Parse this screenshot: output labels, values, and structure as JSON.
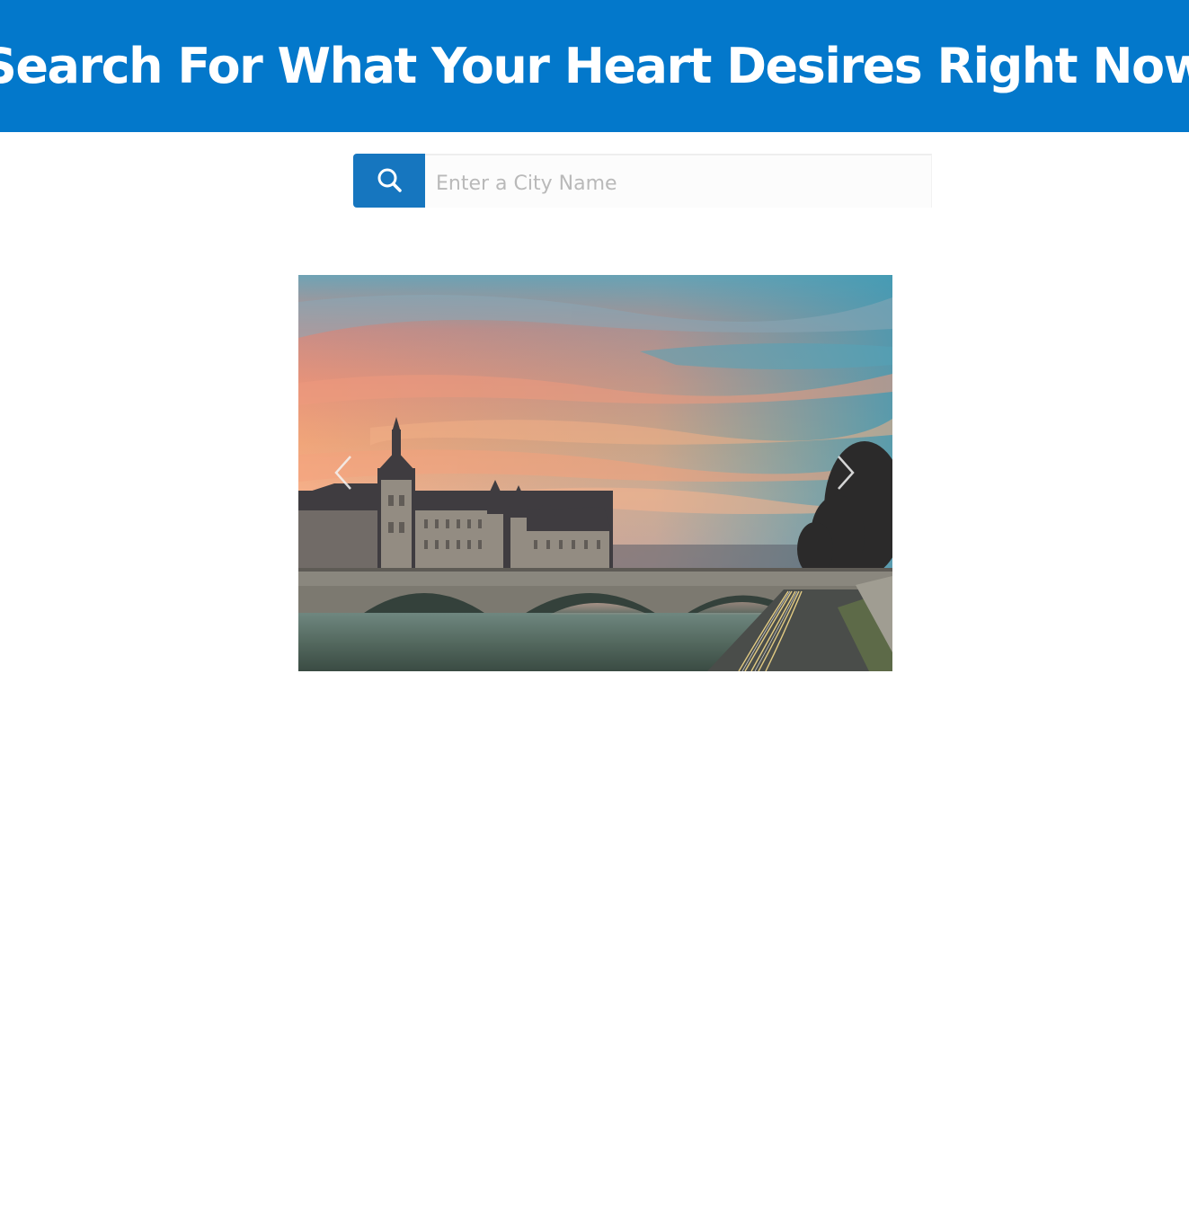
{
  "header": {
    "title": "Search For What Your Heart Desires Right Now",
    "background": "#0378cb"
  },
  "search": {
    "button_icon": "search-icon",
    "button_color": "#1676bf",
    "placeholder": "Enter a City Name",
    "value": ""
  },
  "carousel": {
    "image_subject": "paris-conciergerie-bridge-sunset",
    "prev_icon": "chevron-left-icon",
    "next_icon": "chevron-right-icon"
  }
}
